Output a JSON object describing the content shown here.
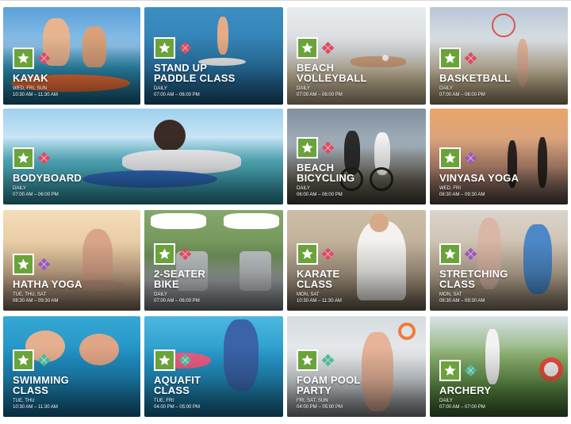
{
  "activities": [
    {
      "title": [
        "KAYAK"
      ],
      "days": "WED, FRI, SUN",
      "time": "10:30 AM – 11:30 AM",
      "accent": "#d94c63"
    },
    {
      "title": [
        "STAND UP",
        "PADDLE CLASS"
      ],
      "days": "DAILY",
      "time": "07:00 AM – 06:00 PM",
      "accent": "#d94c63"
    },
    {
      "title": [
        "BEACH",
        "VOLLEYBALL"
      ],
      "days": "DAILY",
      "time": "07:00 AM – 06:00 PM",
      "accent": "#d94c63"
    },
    {
      "title": [
        "BASKETBALL"
      ],
      "days": "DAILY",
      "time": "07:00 AM – 06:00 PM",
      "accent": "#d94c63"
    },
    {
      "title": [
        "BODYBOARD"
      ],
      "days": "DAILY",
      "time": "07:00 AM – 06:00 PM",
      "accent": "#d94c63"
    },
    {
      "title": [
        "BEACH",
        "BICYCLING"
      ],
      "days": "DAILY",
      "time": "06:00 AM – 06:00 PM",
      "accent": "#d94c63"
    },
    {
      "title": [
        "VINYASA YOGA"
      ],
      "days": "WED, FRI",
      "time": "08:30 AM – 09:30 AM",
      "accent": "#9b59b6"
    },
    {
      "title": [
        "HATHA YOGA"
      ],
      "days": "TUE, THU, SAT",
      "time": "08:30 AM – 09:30 AM",
      "accent": "#9b59b6"
    },
    {
      "title": [
        "2-SEATER",
        "BIKE"
      ],
      "days": "DAILY",
      "time": "07:00 AM – 06:00 PM",
      "accent": "#d94c63"
    },
    {
      "title": [
        "KARATE",
        "CLASS"
      ],
      "days": "MON, SAT",
      "time": "10:30 AM – 11:30 AM",
      "accent": "#d94c63"
    },
    {
      "title": [
        "STRETCHING",
        "CLASS"
      ],
      "days": "MON, SAT",
      "time": "08:30 AM – 09:30 AM",
      "accent": "#9b59b6"
    },
    {
      "title": [
        "SWIMMING",
        "CLASS"
      ],
      "days": "TUE, THU",
      "time": "10:30 AM – 11:30 AM",
      "accent": "#4fb79a"
    },
    {
      "title": [
        "AQUAFIT",
        "CLASS"
      ],
      "days": "TUE, FRI",
      "time": "04:00 PM – 05:00 PM",
      "accent": "#4fb79a"
    },
    {
      "title": [
        "FOAM POOL",
        "PARTY"
      ],
      "days": "FRI, SAT, SUN",
      "time": "04:00 PM – 05:00 PM",
      "accent": "#4fb79a"
    },
    {
      "title": [
        "ARCHERY"
      ],
      "days": "DAILY",
      "time": "07:00 AM – 07:00 PM",
      "accent": "#4fb79a"
    }
  ]
}
